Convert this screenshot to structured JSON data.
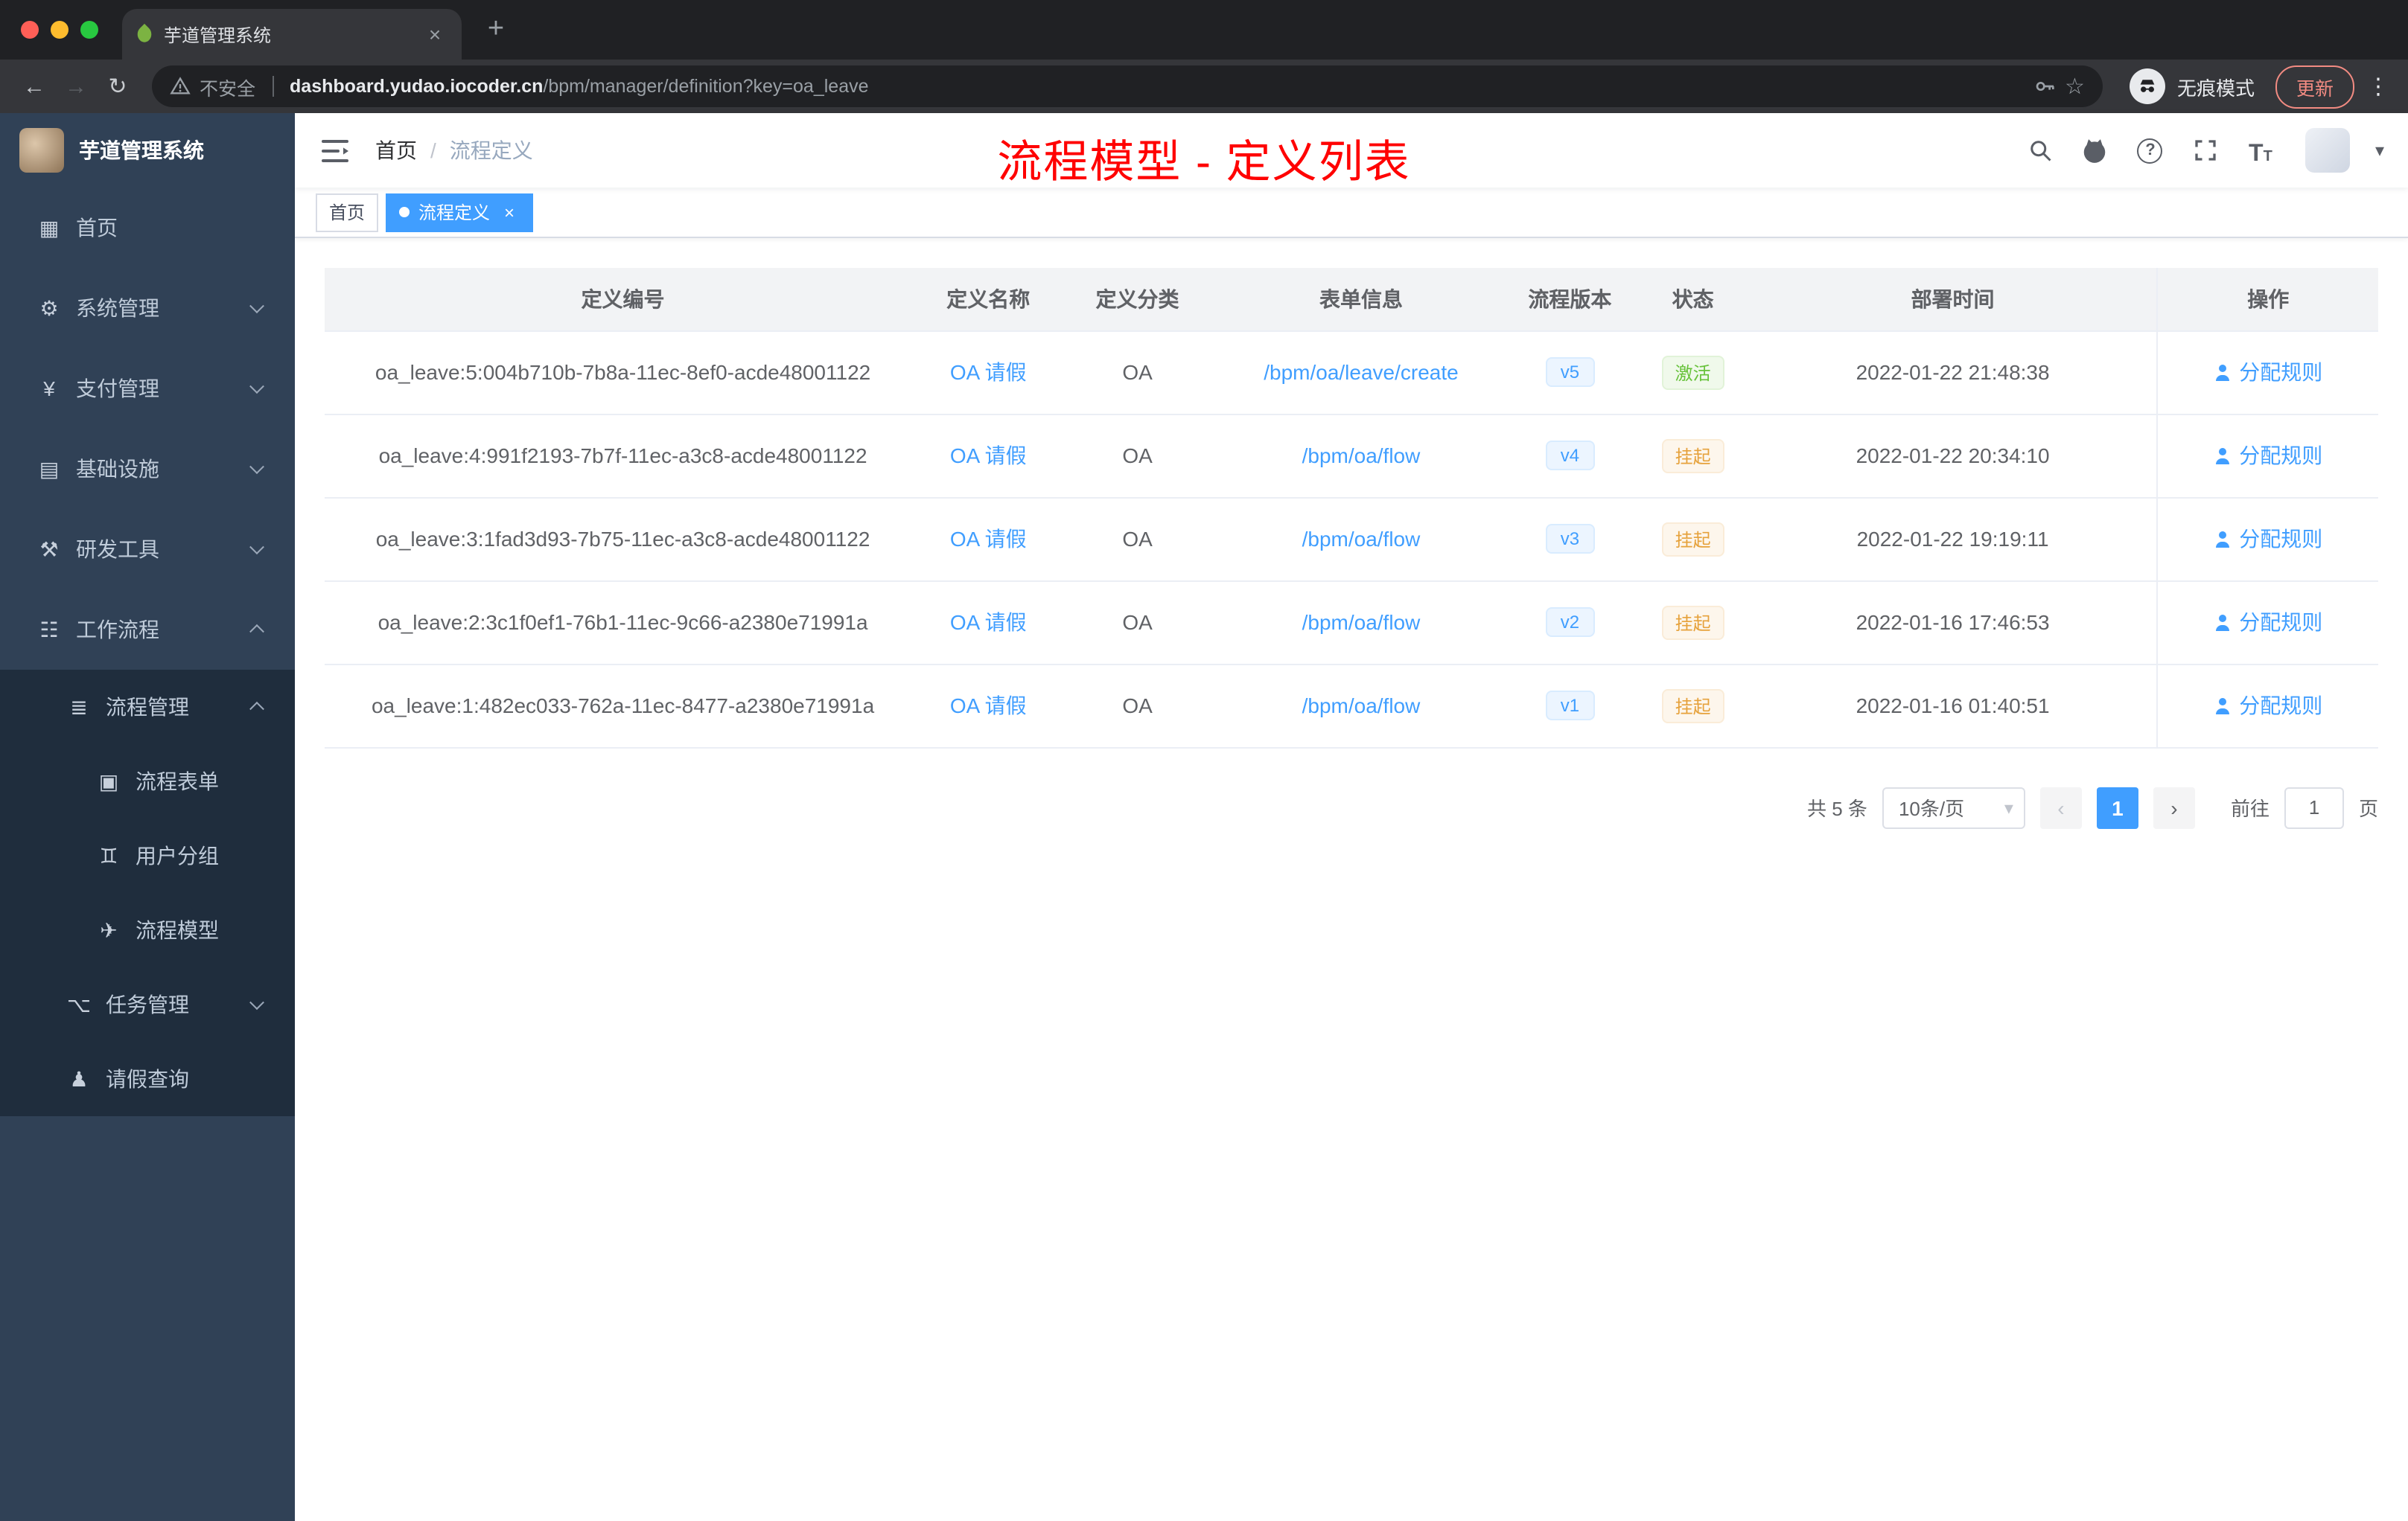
{
  "colors": {
    "primary": "#409eff",
    "success": "#67c23a",
    "warning": "#e6a23c",
    "title_red": "#ff0000",
    "sidebar_bg": "#304156",
    "submenu_bg": "#1f2d3d"
  },
  "icons": {
    "back": "←",
    "forward": "→",
    "reload": "↻",
    "star": "☆",
    "more_vertical": "⋮",
    "new_tab": "+",
    "close": "×",
    "caret_down": "▾",
    "help": "?",
    "font_large": "T",
    "font_small": "T"
  },
  "browser": {
    "tab_title": "芋道管理系统",
    "security_label": "不安全",
    "url_host": "dashboard.yudao.iocoder.cn",
    "url_path": "/bpm/manager/definition?key=oa_leave",
    "incognito_label": "无痕模式",
    "update_button": "更新"
  },
  "sidebar": {
    "logo_title": "芋道管理系统",
    "menu": [
      {
        "label": "首页",
        "icon": "dashboard-icon",
        "glyph": "▦"
      },
      {
        "label": "系统管理",
        "icon": "gear-icon",
        "glyph": "⚙"
      },
      {
        "label": "支付管理",
        "icon": "yen-icon",
        "glyph": "¥"
      },
      {
        "label": "基础设施",
        "icon": "infrastructure-icon",
        "glyph": "▤"
      },
      {
        "label": "研发工具",
        "icon": "devtools-icon",
        "glyph": "⚒"
      },
      {
        "label": "工作流程",
        "icon": "workflow-icon",
        "glyph": "☷"
      },
      {
        "label": "流程管理",
        "icon": "process-mgmt-icon",
        "glyph": "≣"
      },
      {
        "label": "流程表单",
        "icon": "form-icon",
        "glyph": "▣"
      },
      {
        "label": "用户分组",
        "icon": "user-group-icon",
        "glyph": "♊"
      },
      {
        "label": "流程模型",
        "icon": "send-icon",
        "glyph": "✈"
      },
      {
        "label": "任务管理",
        "icon": "task-mgmt-icon",
        "glyph": "⌥"
      },
      {
        "label": "请假查询",
        "icon": "user-icon",
        "glyph": "♟"
      }
    ]
  },
  "navbar": {
    "breadcrumb": {
      "home": "首页",
      "separator": "/",
      "current": "流程定义"
    },
    "overlay_title": "流程模型 - 定义列表"
  },
  "tags_view": {
    "tags": [
      {
        "label": "首页"
      },
      {
        "label": "流程定义"
      }
    ]
  },
  "table": {
    "columns": [
      "定义编号",
      "定义名称",
      "定义分类",
      "表单信息",
      "流程版本",
      "状态",
      "部署时间",
      "操作"
    ],
    "rows": [
      {
        "id": "oa_leave:5:004b710b-7b8a-11ec-8ef0-acde48001122",
        "name": "OA 请假",
        "category": "OA",
        "form": "/bpm/oa/leave/create",
        "version": "v5",
        "status": "激活",
        "deploy_time": "2022-01-22 21:48:38",
        "action": "分配规则"
      },
      {
        "id": "oa_leave:4:991f2193-7b7f-11ec-a3c8-acde48001122",
        "name": "OA 请假",
        "category": "OA",
        "form": "/bpm/oa/flow",
        "version": "v4",
        "status": "挂起",
        "deploy_time": "2022-01-22 20:34:10",
        "action": "分配规则"
      },
      {
        "id": "oa_leave:3:1fad3d93-7b75-11ec-a3c8-acde48001122",
        "name": "OA 请假",
        "category": "OA",
        "form": "/bpm/oa/flow",
        "version": "v3",
        "status": "挂起",
        "deploy_time": "2022-01-22 19:19:11",
        "action": "分配规则"
      },
      {
        "id": "oa_leave:2:3c1f0ef1-76b1-11ec-9c66-a2380e71991a",
        "name": "OA 请假",
        "category": "OA",
        "form": "/bpm/oa/flow",
        "version": "v2",
        "status": "挂起",
        "deploy_time": "2022-01-16 17:46:53",
        "action": "分配规则"
      },
      {
        "id": "oa_leave:1:482ec033-762a-11ec-8477-a2380e71991a",
        "name": "OA 请假",
        "category": "OA",
        "form": "/bpm/oa/flow",
        "version": "v1",
        "status": "挂起",
        "deploy_time": "2022-01-16 01:40:51",
        "action": "分配规则"
      }
    ]
  },
  "pagination": {
    "total": "共 5 条",
    "page_size": "10条/页",
    "prev": "‹",
    "current_page": "1",
    "next": "›",
    "goto_label": "前往",
    "goto_value": "1",
    "unit_label": "页"
  }
}
